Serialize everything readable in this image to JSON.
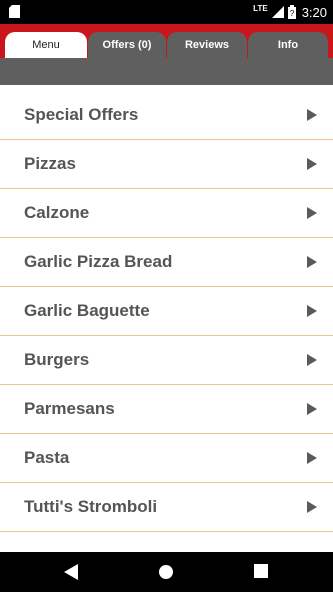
{
  "status_bar": {
    "network": "LTE",
    "time": "3:20",
    "icons": [
      "sd-card-icon",
      "signal-icon",
      "battery-icon"
    ]
  },
  "tabs": [
    {
      "label": "Menu",
      "active": true
    },
    {
      "label": "Offers (0)",
      "active": false
    },
    {
      "label": "Reviews",
      "active": false
    },
    {
      "label": "Info",
      "active": false
    }
  ],
  "menu": {
    "items": [
      {
        "label": "Special Offers"
      },
      {
        "label": "Pizzas"
      },
      {
        "label": "Calzone"
      },
      {
        "label": "Garlic Pizza Bread"
      },
      {
        "label": "Garlic Baguette"
      },
      {
        "label": "Burgers"
      },
      {
        "label": "Parmesans"
      },
      {
        "label": "Pasta"
      },
      {
        "label": "Tutti's Stromboli"
      }
    ]
  },
  "navigation": {
    "back": "back-icon",
    "home": "home-icon",
    "recent": "recent-apps-icon"
  },
  "colors": {
    "accent_red": "#c9161d",
    "tab_grey": "#5f5f5f",
    "divider": "#f0c58a",
    "item_text": "#555555"
  }
}
